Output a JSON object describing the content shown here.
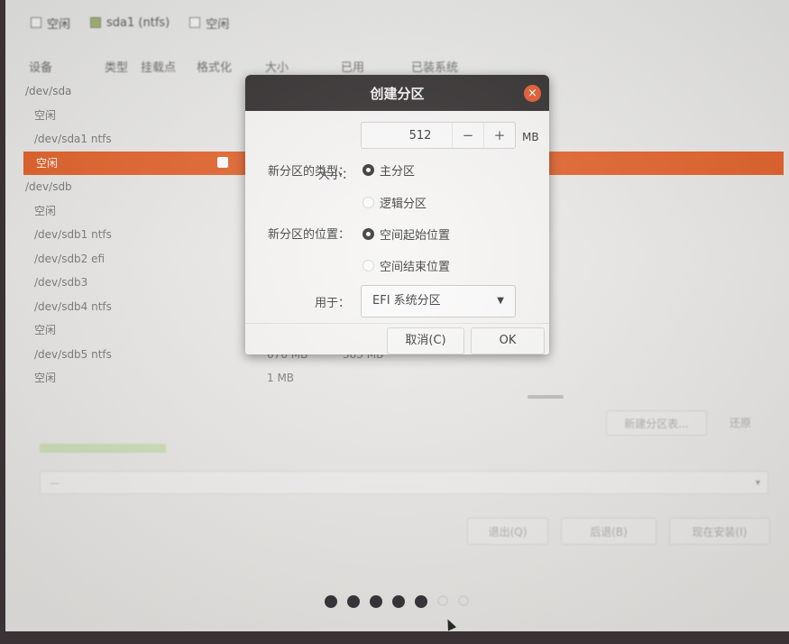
{
  "top_strip": {
    "items": [
      {
        "label": "空闲",
        "swatch": "#f3f3f3"
      },
      {
        "label": "sda1 (ntfs)",
        "swatch": "#9fb36a"
      },
      {
        "label": "空闲",
        "swatch": "#f3f3f3"
      }
    ]
  },
  "columns": {
    "device": "设备",
    "type": "类型",
    "mount": "挂载点",
    "format": "格式化",
    "size": "大小",
    "used": "已用",
    "installed": "已装系统"
  },
  "partitions": [
    {
      "name": "/dev/sda",
      "indent": false,
      "size": "",
      "used": ""
    },
    {
      "name": "空闲",
      "indent": true,
      "size": "",
      "used": ""
    },
    {
      "name": "/dev/sda1  ntfs",
      "indent": true,
      "size": "",
      "used": ""
    },
    {
      "name": "空闲",
      "indent": true,
      "size": "",
      "used": "",
      "selected": true
    },
    {
      "name": "/dev/sdb",
      "indent": false,
      "size": "",
      "used": ""
    },
    {
      "name": "空闲",
      "indent": true,
      "size": "",
      "used": ""
    },
    {
      "name": "/dev/sdb1  ntfs",
      "indent": true,
      "size": "",
      "used": ""
    },
    {
      "name": "/dev/sdb2  efi",
      "indent": true,
      "size": "",
      "used": ""
    },
    {
      "name": "/dev/sdb3",
      "indent": true,
      "size": "",
      "used": ""
    },
    {
      "name": "/dev/sdb4  ntfs",
      "indent": true,
      "size": "",
      "used": ""
    },
    {
      "name": "空闲",
      "indent": true,
      "size": "",
      "used": ""
    },
    {
      "name": "/dev/sdb5  ntfs",
      "indent": true,
      "size": "676 MB",
      "used": "383 MB"
    },
    {
      "name": "空闲",
      "indent": true,
      "size": "1 MB",
      "used": ""
    }
  ],
  "lower_panel": {
    "new_table_button": "新建分区表...",
    "revert_button": "还原",
    "quit_button": "退出(Q)",
    "back_button": "后退(B)",
    "install_now_button": "现在安装(I)"
  },
  "dialog": {
    "title": "创建分区",
    "size_label": "大小：",
    "size_value": "512",
    "size_unit": "MB",
    "minus": "−",
    "plus": "+",
    "type_label": "新分区的类型：",
    "type_primary": "主分区",
    "type_logical": "逻辑分区",
    "position_label": "新分区的位置：",
    "position_start": "空间起始位置",
    "position_end": "空间结束位置",
    "use_as_label": "用于：",
    "use_as_value": "EFI 系统分区",
    "cancel": "取消(C)",
    "ok": "OK",
    "close_icon": "×"
  },
  "progress": {
    "filled": 5,
    "total": 7
  },
  "colors": {
    "accent": "#e3622a",
    "titlebar": "#2f2b2c",
    "close": "#e2582c"
  }
}
